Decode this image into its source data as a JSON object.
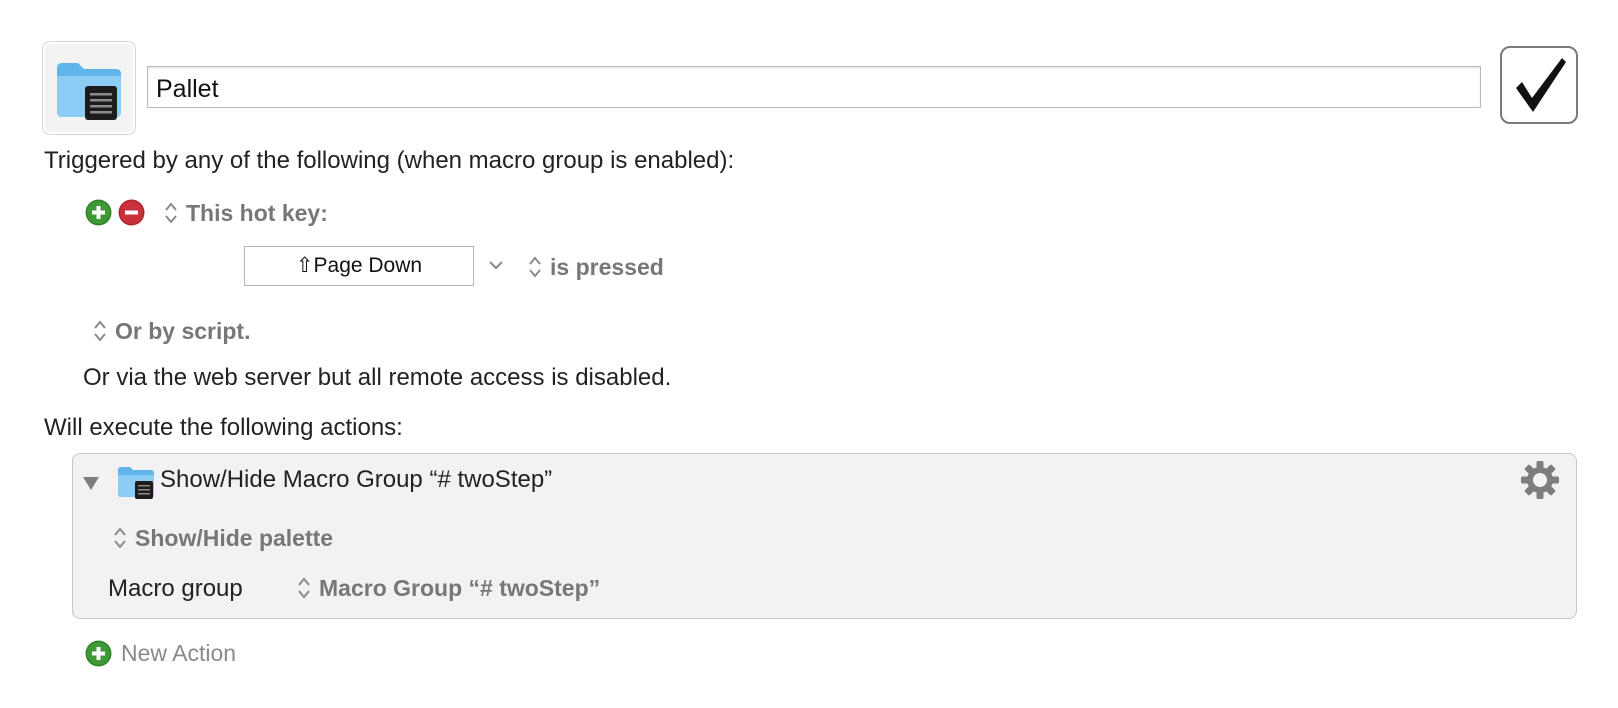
{
  "macro": {
    "icon": "folder-palette-icon",
    "name": "Pallet",
    "enabled": true
  },
  "triggers": {
    "heading": "Triggered by any of the following (when macro group is enabled):",
    "hotkey": {
      "type_label": "This hot key:",
      "key_value": "⇧Page Down",
      "condition_label": "is pressed"
    },
    "script_label": "Or by script.",
    "web_server_text": "Or via the web server but all remote access is disabled."
  },
  "actions": {
    "heading": "Will execute the following actions:",
    "items": [
      {
        "title": "Show/Hide Macro Group “# twoStep”",
        "mode_label": "Show/Hide palette",
        "group_field_label": "Macro group",
        "group_value": "Macro Group “# twoStep”"
      }
    ],
    "new_action_label": "New Action"
  },
  "colors": {
    "add_green": "#3f9a35",
    "remove_red": "#c9323a",
    "action_bg": "#f2f2f2",
    "grey_text": "#777777"
  }
}
